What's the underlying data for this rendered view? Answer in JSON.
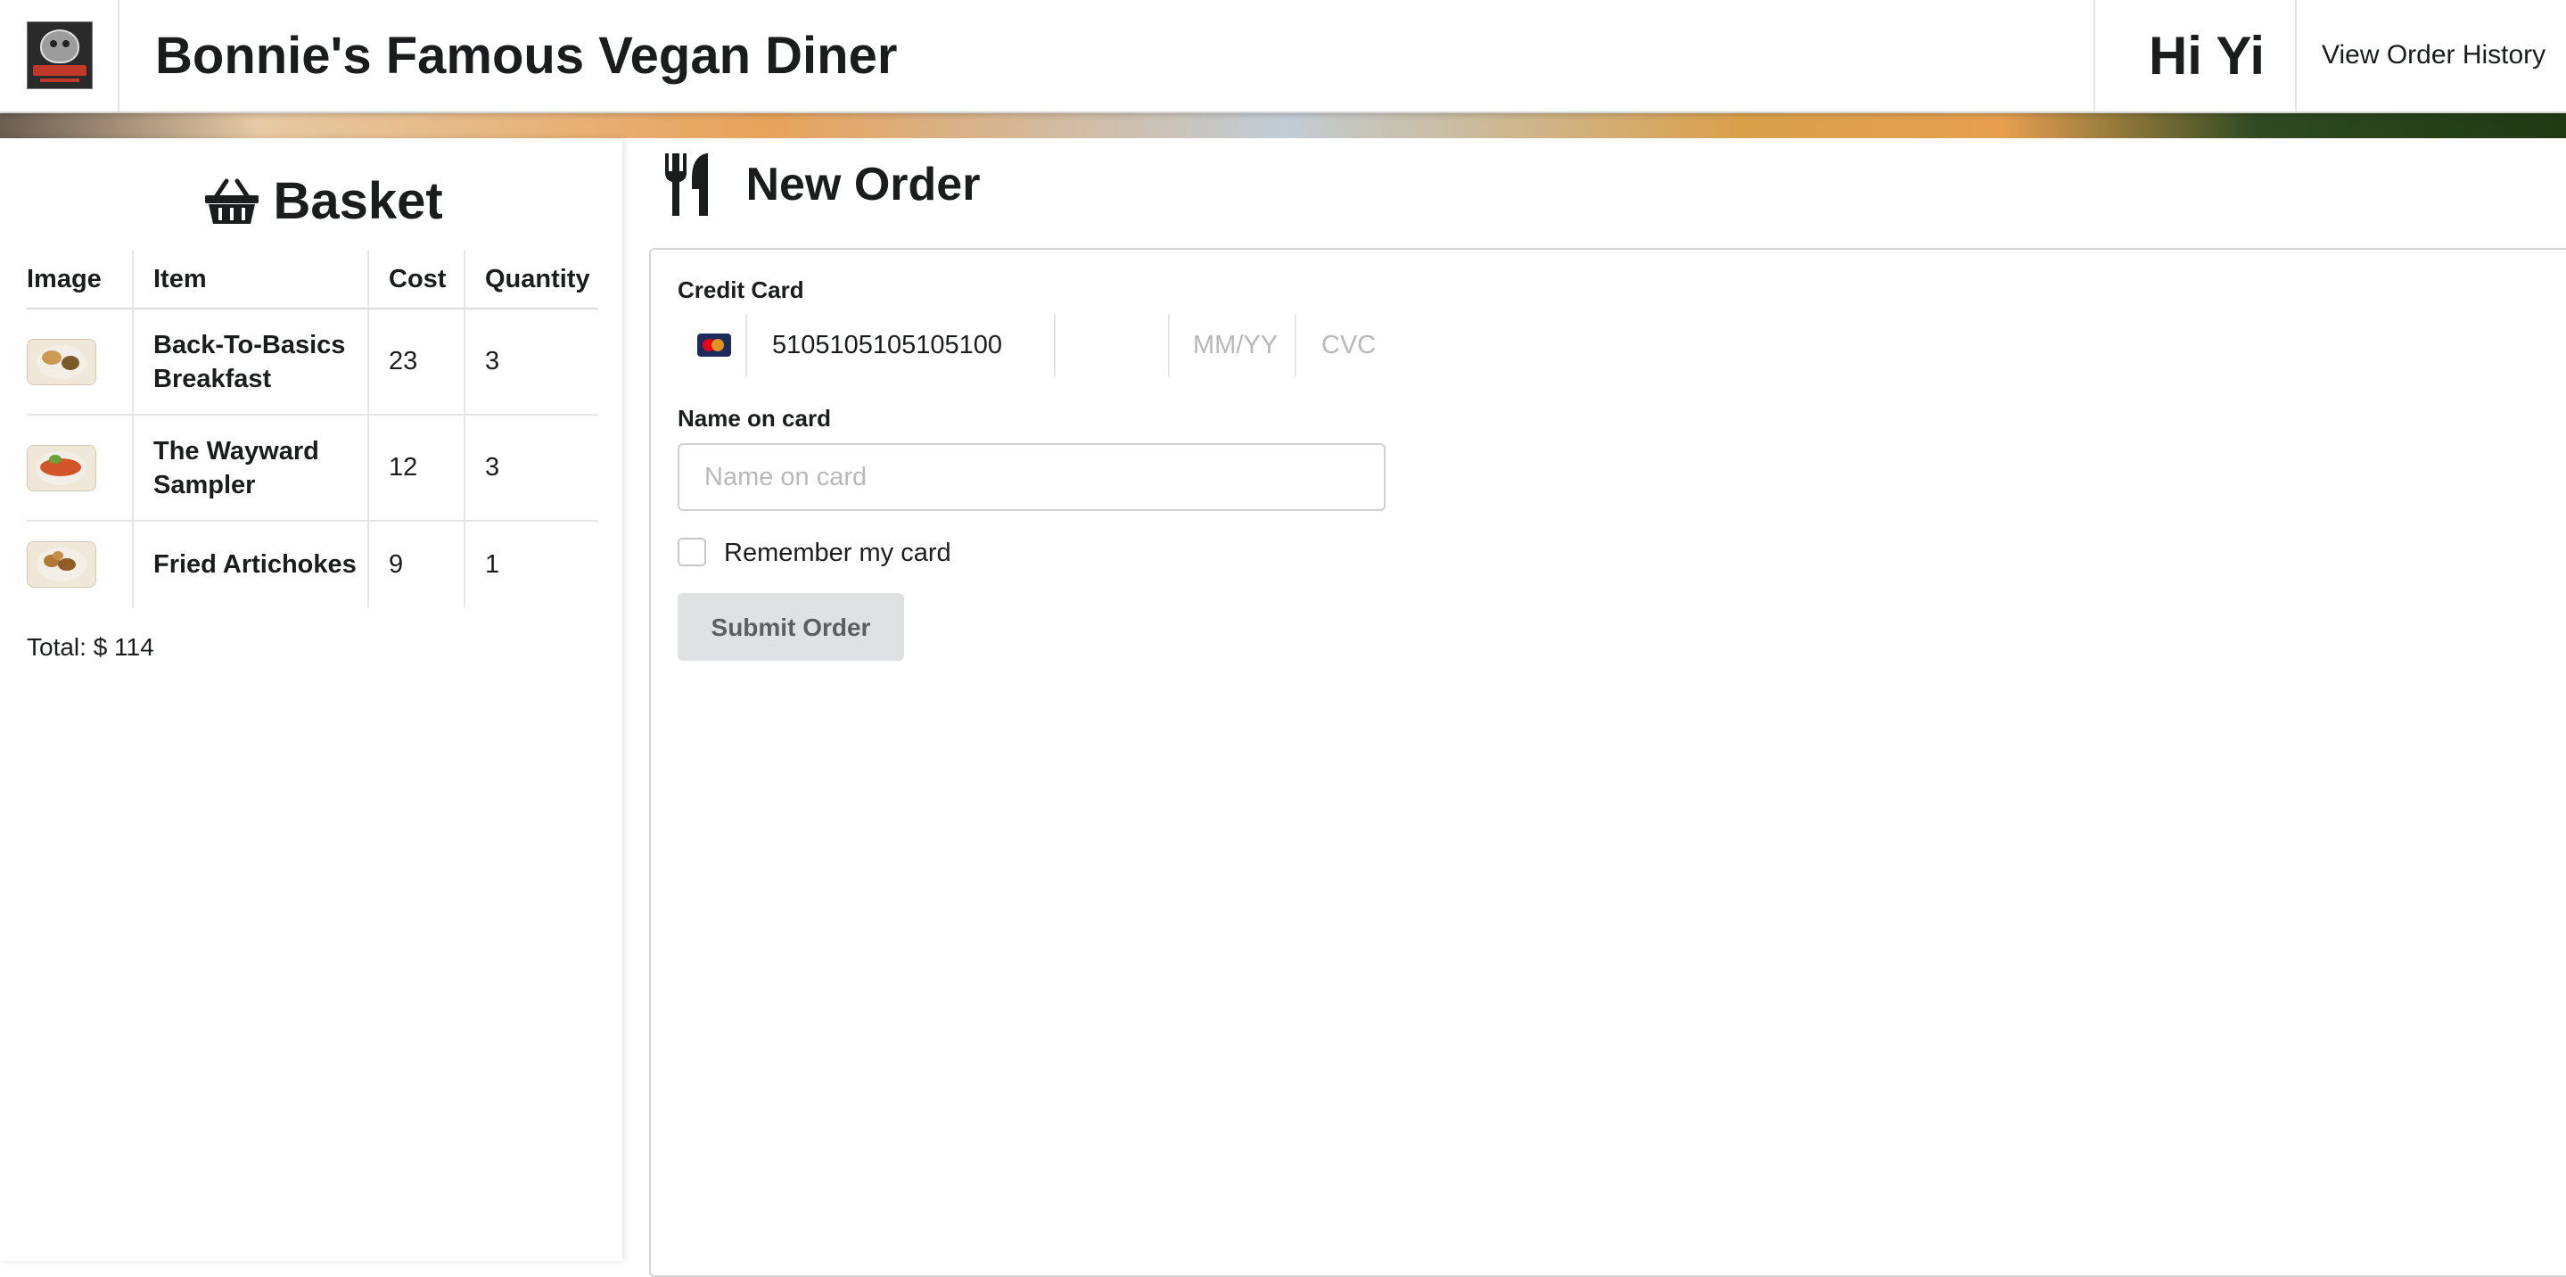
{
  "header": {
    "logo_alt": "Bonnie's",
    "site_title": "Bonnie's Famous Vegan Diner",
    "greeting": "Hi Yi",
    "history_link": "View Order History"
  },
  "basket": {
    "title": "Basket",
    "icon": "basket-icon",
    "columns": [
      "Image",
      "Item",
      "Cost",
      "Quantity"
    ],
    "rows": [
      {
        "item": "Back-To-Basics Breakfast",
        "cost": "23",
        "quantity": "3"
      },
      {
        "item": "The Wayward Sampler",
        "cost": "12",
        "quantity": "3"
      },
      {
        "item": "Fried Artichokes",
        "cost": "9",
        "quantity": "1"
      }
    ],
    "total": "Total: $ 114"
  },
  "order": {
    "title": "New Order",
    "icon": "utensils-icon",
    "credit_card_label": "Credit Card",
    "card_number": "5105105105105100",
    "expiry_placeholder": "MM/YY",
    "cvc_placeholder": "CVC",
    "name_label": "Name on card",
    "name_placeholder": "Name on card",
    "remember_label": "Remember my card",
    "submit_label": "Submit Order"
  }
}
